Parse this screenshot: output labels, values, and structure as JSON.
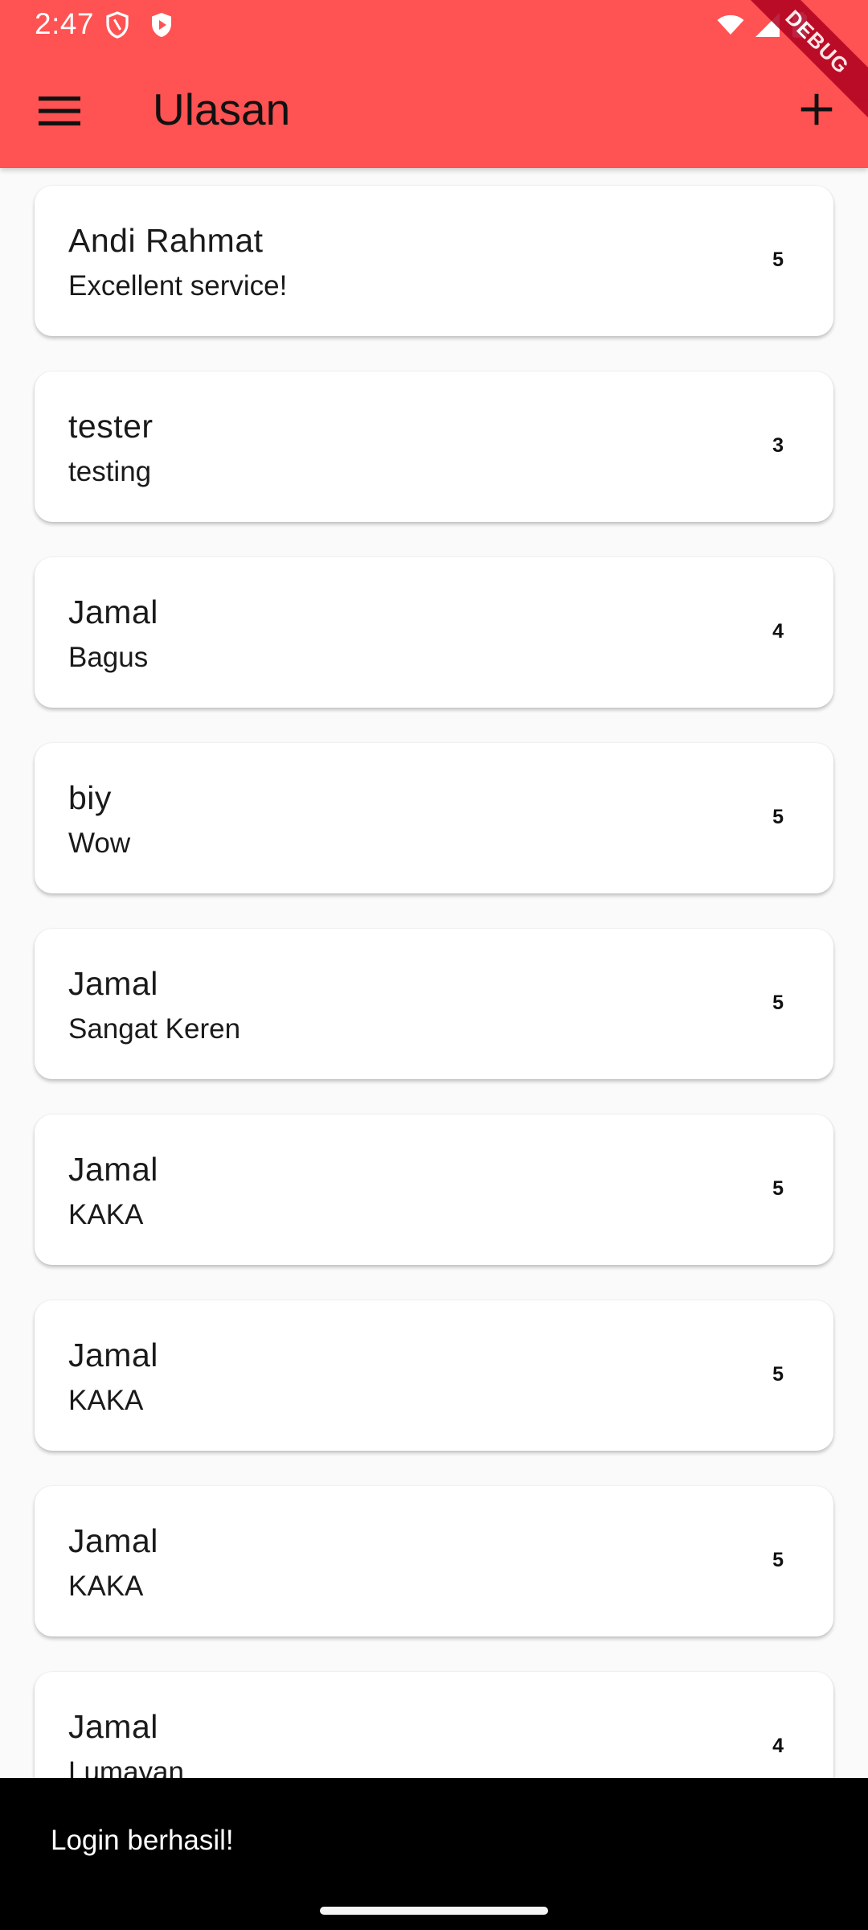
{
  "status_bar": {
    "time": "2:47",
    "left_icons": [
      "shield-icon",
      "play-protect-icon"
    ],
    "right_icons": [
      "wifi-icon",
      "signal-icon",
      "battery-icon"
    ]
  },
  "debug_banner": "DEBUG",
  "app_bar": {
    "title": "Ulasan",
    "menu_icon": "hamburger-menu-icon",
    "action_icon": "add-icon",
    "background_color": "#ff5252"
  },
  "reviews": [
    {
      "name": "Andi Rahmat",
      "comment": "Excellent service!",
      "rating": "5"
    },
    {
      "name": "tester",
      "comment": "testing",
      "rating": "3"
    },
    {
      "name": "Jamal",
      "comment": "Bagus",
      "rating": "4"
    },
    {
      "name": "biy",
      "comment": "Wow",
      "rating": "5"
    },
    {
      "name": "Jamal",
      "comment": "Sangat Keren",
      "rating": "5"
    },
    {
      "name": "Jamal",
      "comment": "KAKA",
      "rating": "5"
    },
    {
      "name": "Jamal",
      "comment": "KAKA",
      "rating": "5"
    },
    {
      "name": "Jamal",
      "comment": "KAKA",
      "rating": "5"
    },
    {
      "name": "Jamal",
      "comment": "Lumayan",
      "rating": "4"
    }
  ],
  "snackbar": {
    "message": "Login berhasil!"
  }
}
